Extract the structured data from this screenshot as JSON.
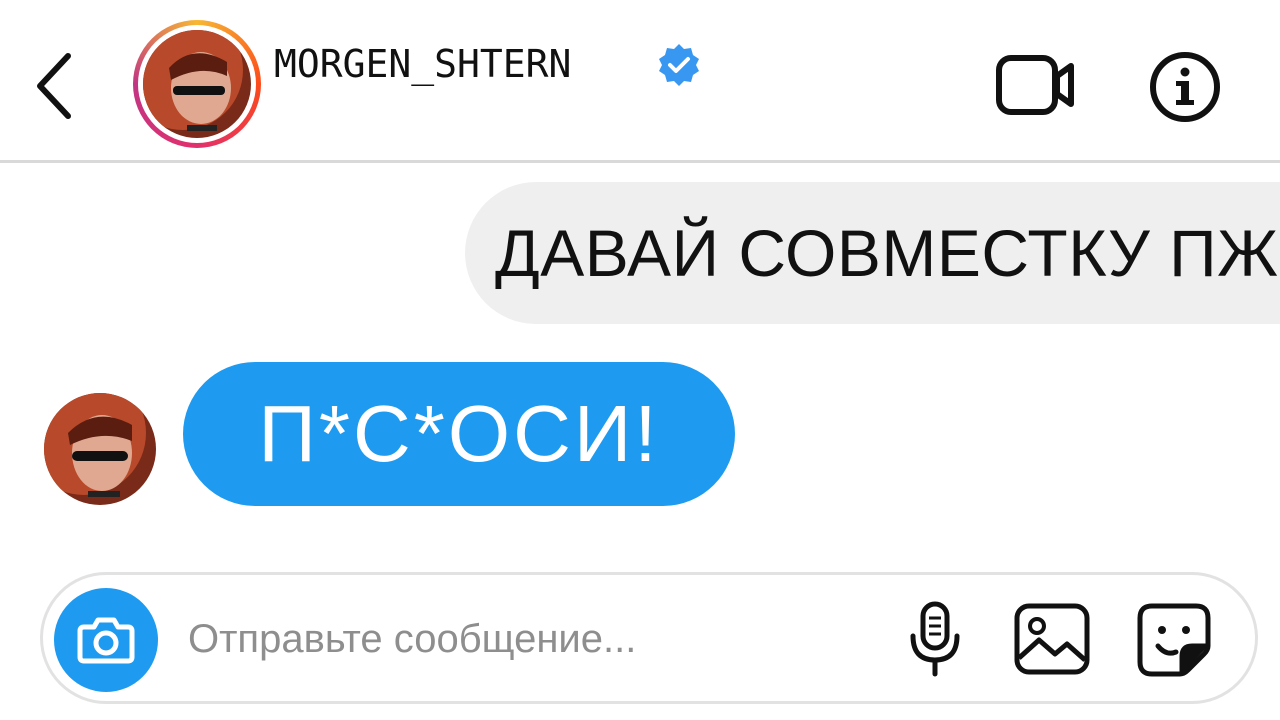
{
  "header": {
    "username": "MORGEN_SHTERN",
    "verified": true,
    "icons": [
      "back-chevron-icon",
      "verified-badge-icon",
      "video-call-icon",
      "info-icon"
    ]
  },
  "messages": [
    {
      "direction": "outgoing",
      "text": "ДАВАЙ СОВМЕСТКУ ПЖ"
    },
    {
      "direction": "incoming",
      "text": "П*С*ОСИ!"
    }
  ],
  "composer": {
    "placeholder": "Отправьте сообщение...",
    "value": "",
    "icons": [
      "camera-icon",
      "microphone-icon",
      "gallery-icon",
      "sticker-icon"
    ]
  },
  "colors": {
    "accent": "#1e9bf0",
    "outgoing_bubble": "#efefef",
    "text": "#111111",
    "placeholder": "#8e8e8e",
    "divider": "#d9d9d9"
  }
}
